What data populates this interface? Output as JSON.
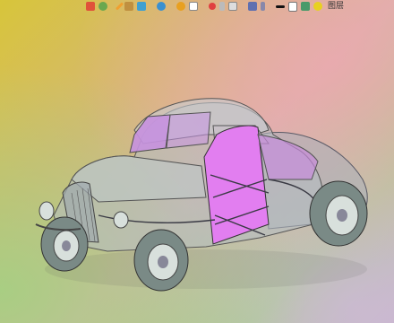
{
  "toolbar": {
    "label": "图层",
    "icons": [
      "move-icon",
      "select-icon",
      "pencil-icon",
      "part-icon",
      "box-icon",
      "rotate-icon",
      "view-orientation-icon",
      "display-style-icon",
      "hide-show-icon",
      "section-view-icon",
      "view-icon",
      "zoom-icon",
      "lighting-icon",
      "appearance-icon",
      "scene-icon",
      "color-black-icon",
      "window-icon",
      "layer-icon",
      "lightbulb-icon"
    ]
  },
  "colors": {
    "door": "#e27ef0",
    "window": "#c792e0",
    "body_line": "#6a6a78",
    "tire": "#7a8a86",
    "wheel_rim": "#d8e0dc"
  }
}
